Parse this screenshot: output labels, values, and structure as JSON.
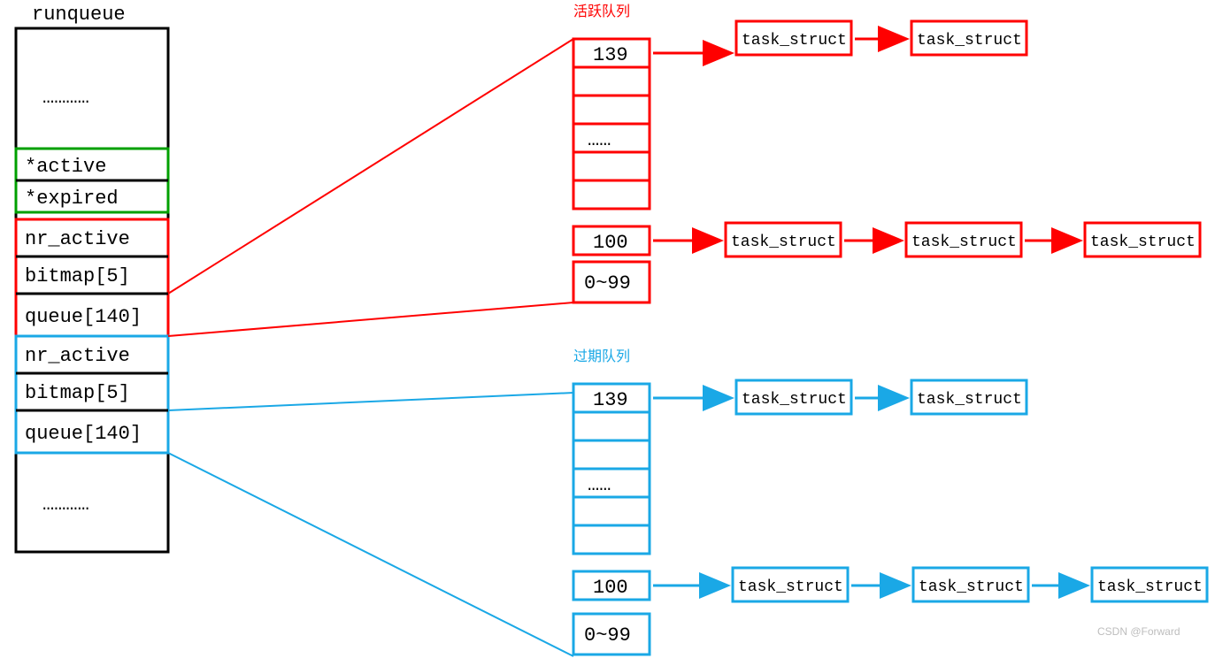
{
  "runqueue": {
    "title": "runqueue",
    "dots_top": "…………",
    "cells": {
      "active": "*active",
      "expired": "*expired",
      "nr_active_1": "nr_active",
      "bitmap_1": "bitmap[5]",
      "queue_1": "queue[140]",
      "nr_active_2": "nr_active",
      "bitmap_2": "bitmap[5]",
      "queue_2": "queue[140]"
    },
    "dots_bottom": "…………"
  },
  "active_queue": {
    "title": "活跃队列",
    "levels": [
      "139",
      "",
      "",
      "……",
      "",
      "",
      "100",
      "0~99"
    ],
    "links": {
      "top": [
        "task_struct",
        "task_struct"
      ],
      "bottom": [
        "task_struct",
        "task_struct",
        "task_struct"
      ]
    }
  },
  "expired_queue": {
    "title": "过期队列",
    "levels": [
      "139",
      "",
      "",
      "……",
      "",
      "",
      "100",
      "0~99"
    ],
    "links": {
      "top": [
        "task_struct",
        "task_struct"
      ],
      "bottom": [
        "task_struct",
        "task_struct",
        "task_struct"
      ]
    }
  },
  "colors": {
    "black": "#000000",
    "red": "#ff0000",
    "green": "#00a000",
    "blue": "#1aa8e6"
  },
  "watermark": "CSDN @Forward"
}
